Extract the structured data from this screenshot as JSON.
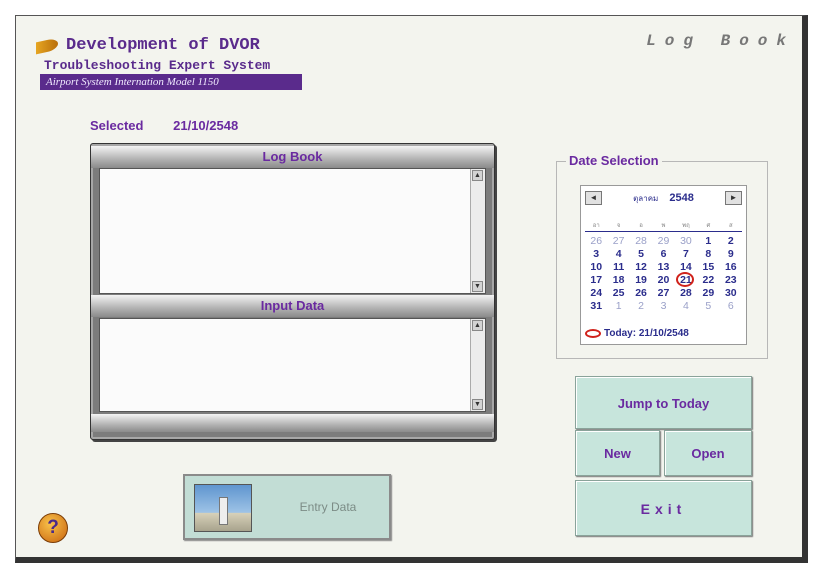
{
  "header": {
    "title": "Development of DVOR",
    "subtitle": "Troubleshooting Expert System",
    "model": "Airport System Internation Model 1150",
    "logbook_title": "Log Book"
  },
  "selected": {
    "label": "Selected",
    "value": "21/10/2548"
  },
  "log_panel": {
    "log_label": "Log Book",
    "input_label": "Input Data"
  },
  "date_selection": {
    "legend": "Date Selection",
    "month_label": "ตุลาคม",
    "year": "2548",
    "prev_glyph": "◄",
    "next_glyph": "►",
    "weekdays": [
      "อา",
      "จ",
      "อ",
      "พ",
      "พฤ",
      "ศ",
      "ส"
    ],
    "weeks": [
      [
        "26",
        "27",
        "28",
        "29",
        "30",
        "1",
        "2"
      ],
      [
        "3",
        "4",
        "5",
        "6",
        "7",
        "8",
        "9"
      ],
      [
        "10",
        "11",
        "12",
        "13",
        "14",
        "15",
        "16"
      ],
      [
        "17",
        "18",
        "19",
        "20",
        "21",
        "22",
        "23"
      ],
      [
        "24",
        "25",
        "26",
        "27",
        "28",
        "29",
        "30"
      ],
      [
        "31",
        "1",
        "2",
        "3",
        "4",
        "5",
        "6"
      ]
    ],
    "selected_day": "21",
    "today_text": "Today: 21/10/2548",
    "highlight_color": "#d0221b"
  },
  "buttons": {
    "jump_today": "Jump to Today",
    "new": "New",
    "open": "Open",
    "exit": "Exit",
    "entry_data": "Entry Data"
  },
  "icons": {
    "help": "help-icon",
    "horn": "horn-icon",
    "thumbnail": "dvor-station-thumbnail"
  },
  "colors": {
    "accent": "#6a2aa0",
    "calendar_text": "#2b2d8c",
    "button_face": "#c7e5dc",
    "band": "#5a2b8c"
  }
}
